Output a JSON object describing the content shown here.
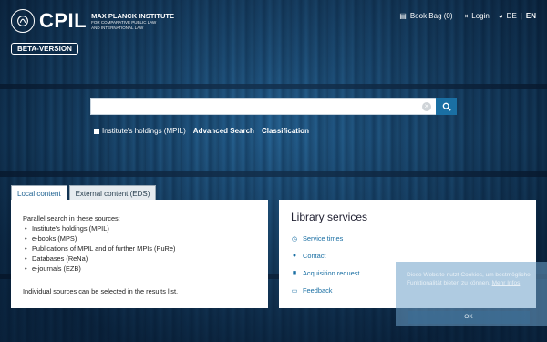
{
  "header": {
    "logo_abbr": "CPIL",
    "logo_line1": "MAX PLANCK INSTITUTE",
    "logo_line2": "FOR COMPARATIVE PUBLIC LAW",
    "logo_line3": "AND INTERNATIONAL LAW",
    "beta_label": "BETA-VERSION",
    "book_bag": "Book Bag (0)",
    "login": "Login",
    "lang_de": "DE",
    "lang_sep": "|",
    "lang_en": "EN"
  },
  "search": {
    "value": "",
    "placeholder": "",
    "clear_glyph": "×",
    "options": {
      "holdings": "Institute's holdings (MPIL)",
      "advanced": "Advanced Search",
      "classification": "Classification"
    }
  },
  "tabs": [
    {
      "label": "Local content"
    },
    {
      "label": "External content (EDS)"
    }
  ],
  "local": {
    "intro": "Parallel search in these sources:",
    "sources": [
      "Institute's holdings (MPIL)",
      "e-books (MPS)",
      "Publications of MPIL and of further MPIs (PuRe)",
      "Databases (ReNa)",
      "e-journals (EZB)"
    ],
    "note": "Individual sources can be selected in the results list."
  },
  "services": {
    "title": "Library services",
    "items": [
      {
        "label": "Service times",
        "icon": "clock-icon"
      },
      {
        "label": "Contact",
        "icon": "users-icon"
      },
      {
        "label": "Acquisition request",
        "icon": "lock-icon"
      },
      {
        "label": "Feedback",
        "icon": "comment-icon"
      }
    ]
  },
  "cookie": {
    "text": "Diese Website nutzt Cookies, um bestmögliche Funktionalität bieten zu können.",
    "more": "Mehr Infos",
    "ok": "OK"
  },
  "colors": {
    "accent": "#1a6fa3",
    "background": "#0d2f4c"
  }
}
